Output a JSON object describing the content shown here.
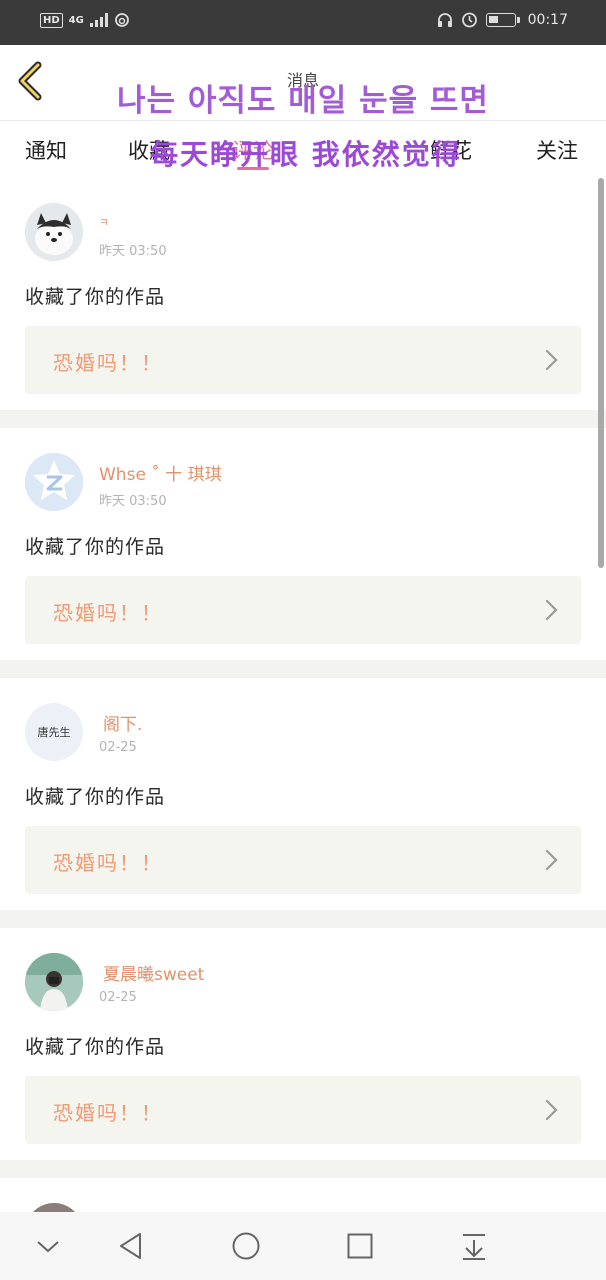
{
  "status_bar": {
    "network": "4G",
    "time": "00:17"
  },
  "header": {
    "title": "消息",
    "overlay_text": "나는 아직도 매일 눈을 뜨면"
  },
  "tabs": {
    "items": [
      {
        "label": "通知"
      },
      {
        "label": "收藏"
      },
      {
        "label": "评论"
      },
      {
        "label": "鲜花"
      },
      {
        "label": "关注"
      }
    ],
    "overlay_text": "每天睁开眼 我依然觉得"
  },
  "notifications": [
    {
      "user": "ㅋ",
      "time": "昨天 03:50",
      "action": "收藏了你的作品",
      "work_title": "恐婚吗！！"
    },
    {
      "user": "Whse ˚ 十 琪琪",
      "time": "昨天 03:50",
      "action": "收藏了你的作品",
      "work_title": "恐婚吗！！"
    },
    {
      "user": "阁下.",
      "time": "02-25",
      "action": "收藏了你的作品",
      "work_title": "恐婚吗！！"
    },
    {
      "user": "夏晨曦sweet",
      "time": "02-25",
      "action": "收藏了你的作品",
      "work_title": "恐婚吗！！"
    }
  ],
  "avatar_text": "唐先生",
  "colors": {
    "accent": "#e4719c",
    "name": "#e4906a",
    "work_title": "#ef9a73",
    "overlay": "#a35bd6"
  },
  "icons": {
    "back": "chevron-left-icon",
    "nav": [
      "chevron-down-icon",
      "back-triangle-icon",
      "home-circle-icon",
      "recents-square-icon",
      "download-icon"
    ]
  }
}
